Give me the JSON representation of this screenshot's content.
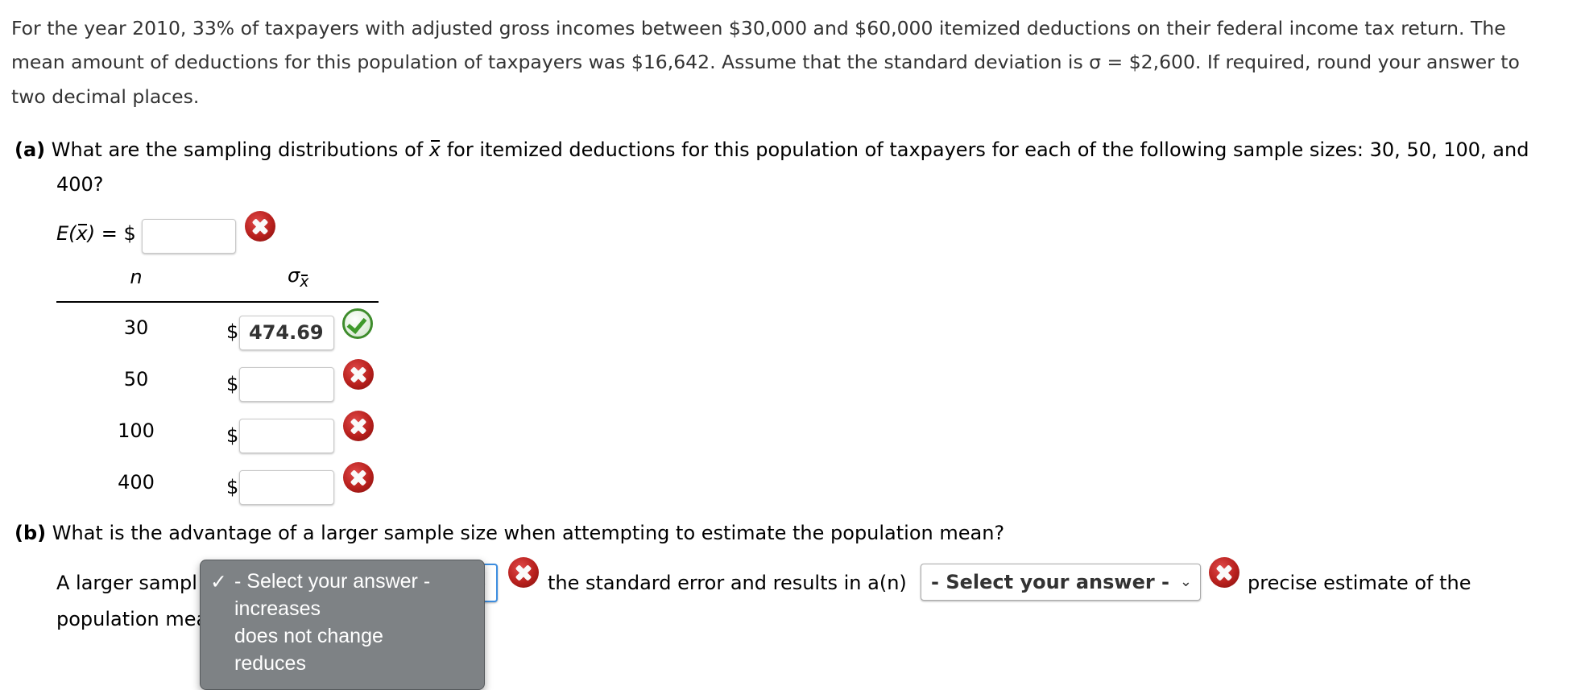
{
  "problem": {
    "line1": "For the year 2010, 33% of taxpayers with adjusted gross incomes between $30,000 and $60,000 itemized deductions on their federal income tax return. The",
    "line2": "mean amount of deductions for this population of taxpayers was $16,642. Assume that the standard deviation is σ = $2,600. If required, round your answer to",
    "line3": "two decimal places."
  },
  "part_a": {
    "label": "(a)",
    "question_pre": "What are the sampling distributions of",
    "question_var": "x",
    "question_post": "for itemized deductions for this population of taxpayers for each of the following sample sizes: 30, 50, 100, and",
    "question_line2": "400?",
    "expected": {
      "label_e": "E(",
      "label_x": "x",
      "label_close": ")",
      "equals": "= $",
      "value": "",
      "status": "incorrect"
    },
    "table": {
      "col_n": "n",
      "col_sigma": "σ",
      "col_sigma_sub": "x",
      "currency": "$",
      "rows": [
        {
          "n": "30",
          "value": "474.69",
          "status": "correct"
        },
        {
          "n": "50",
          "value": "",
          "status": "incorrect"
        },
        {
          "n": "100",
          "value": "",
          "status": "incorrect"
        },
        {
          "n": "400",
          "value": "",
          "status": "incorrect"
        }
      ]
    }
  },
  "part_b": {
    "label": "(b)",
    "question": "What is the advantage of a larger sample size when attempting to estimate the population mean?",
    "sentence_start": "A larger sampl",
    "sentence_line2": "population mea",
    "middle_text": "the standard error and results in a(n)",
    "end_text": "precise estimate of the",
    "select1": {
      "selected": "- Select your answer -",
      "options": [
        "- Select your answer -",
        "increases",
        "does not change",
        "reduces"
      ],
      "open": true,
      "status": "incorrect"
    },
    "select2": {
      "selected": "- Select your answer -",
      "status": "incorrect"
    }
  },
  "icons": {
    "incorrect": "x-circle-icon",
    "correct": "check-circle-icon",
    "chevron": "chevron-down-icon",
    "checkmark": "✓",
    "chevron_glyph": "⌄"
  },
  "colors": {
    "incorrect": "#b8201d",
    "correct": "#3f9a2b",
    "focus": "#3d8ee0",
    "popup_bg": "#7e8285"
  }
}
